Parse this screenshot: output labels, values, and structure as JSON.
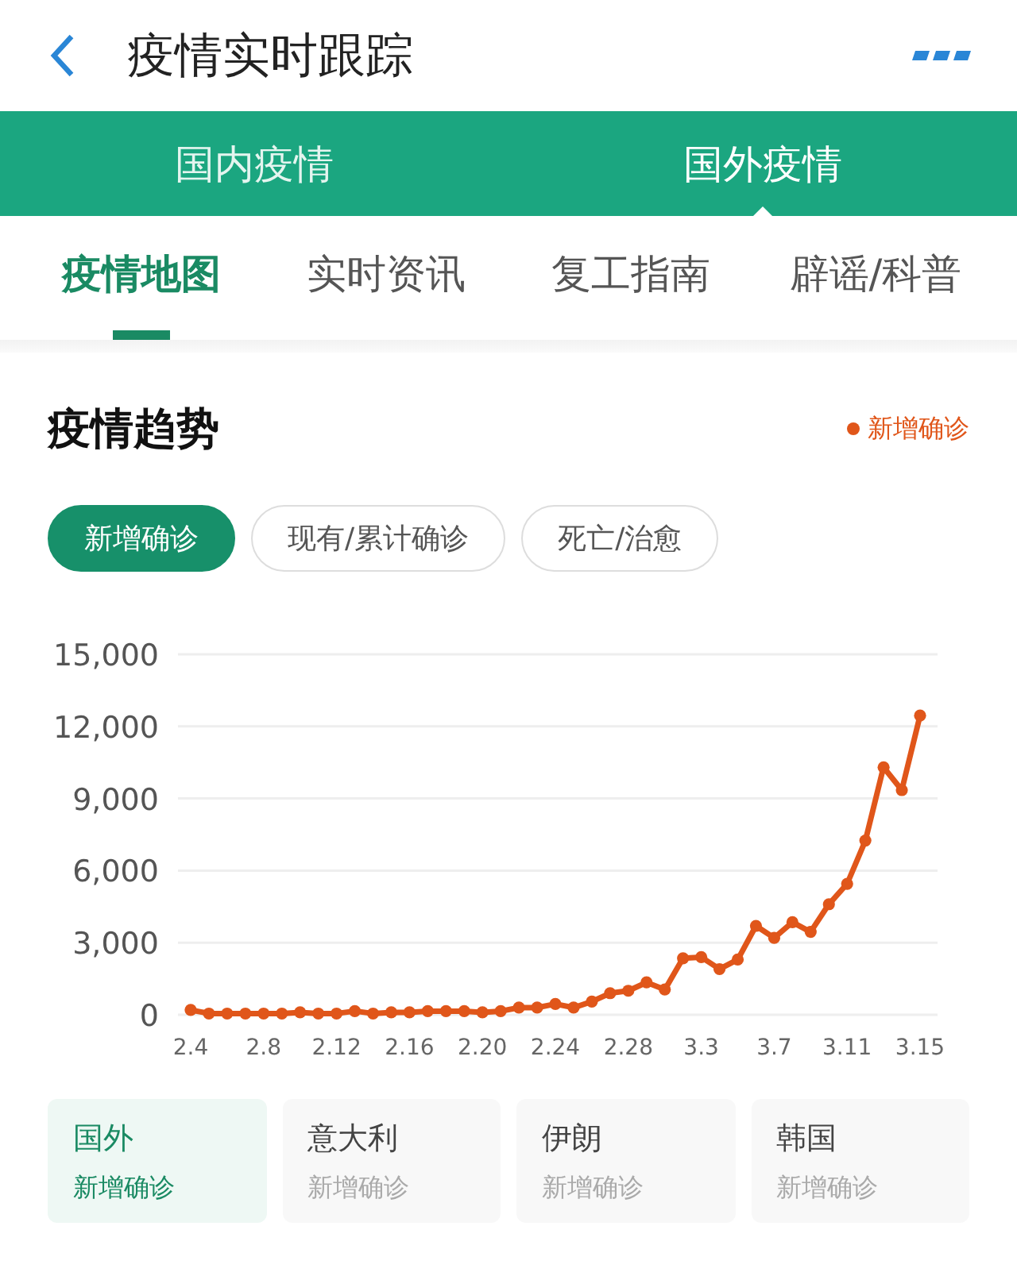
{
  "header": {
    "title": "疫情实时跟踪"
  },
  "main_tabs": [
    {
      "label": "国内疫情",
      "selected": false
    },
    {
      "label": "国外疫情",
      "selected": true
    }
  ],
  "sub_tabs": [
    {
      "label": "疫情地图",
      "selected": true
    },
    {
      "label": "实时资讯",
      "selected": false
    },
    {
      "label": "复工指南",
      "selected": false
    },
    {
      "label": "辟谣/科普",
      "selected": false
    }
  ],
  "trend": {
    "title": "疫情趋势",
    "filters": [
      {
        "label": "新增确诊",
        "selected": true
      },
      {
        "label": "现有/累计确诊",
        "selected": false
      },
      {
        "label": "死亡/治愈",
        "selected": false
      }
    ],
    "chart_data": {
      "type": "line",
      "grid": true,
      "categories": [
        "2.4",
        null,
        null,
        null,
        "2.8",
        null,
        null,
        null,
        "2.12",
        null,
        null,
        null,
        "2.16",
        null,
        null,
        null,
        "2.20",
        null,
        null,
        null,
        "2.24",
        null,
        null,
        null,
        "2.28",
        null,
        null,
        null,
        "3.3",
        null,
        null,
        null,
        "3.7",
        null,
        null,
        null,
        "3.11",
        null,
        null,
        null,
        "3.15"
      ],
      "series": [
        {
          "name": "新增确诊",
          "color": "#e0561a",
          "marker": "circle",
          "values": [
            200,
            50,
            50,
            50,
            50,
            50,
            100,
            50,
            50,
            150,
            50,
            100,
            100,
            150,
            150,
            150,
            100,
            150,
            300,
            300,
            450,
            300,
            550,
            900,
            1000,
            1350,
            1050,
            2350,
            2400,
            1900,
            2300,
            3700,
            3200,
            3850,
            3450,
            4600,
            5450,
            7250,
            10300,
            9350,
            12450
          ]
        }
      ],
      "ylim": [
        0,
        15000
      ],
      "yticks": [
        {
          "value": 0,
          "label": "0"
        },
        {
          "value": 3000,
          "label": "3,000"
        },
        {
          "value": 6000,
          "label": "6,000"
        },
        {
          "value": 9000,
          "label": "9,000"
        },
        {
          "value": 12000,
          "label": "12,000"
        },
        {
          "value": 15000,
          "label": "15,000"
        }
      ]
    }
  },
  "regions": [
    {
      "name": "国外",
      "metric": "新增确诊",
      "selected": true
    },
    {
      "name": "意大利",
      "metric": "新增确诊",
      "selected": false
    },
    {
      "name": "伊朗",
      "metric": "新增确诊",
      "selected": false
    },
    {
      "name": "韩国",
      "metric": "新增确诊",
      "selected": false
    }
  ]
}
